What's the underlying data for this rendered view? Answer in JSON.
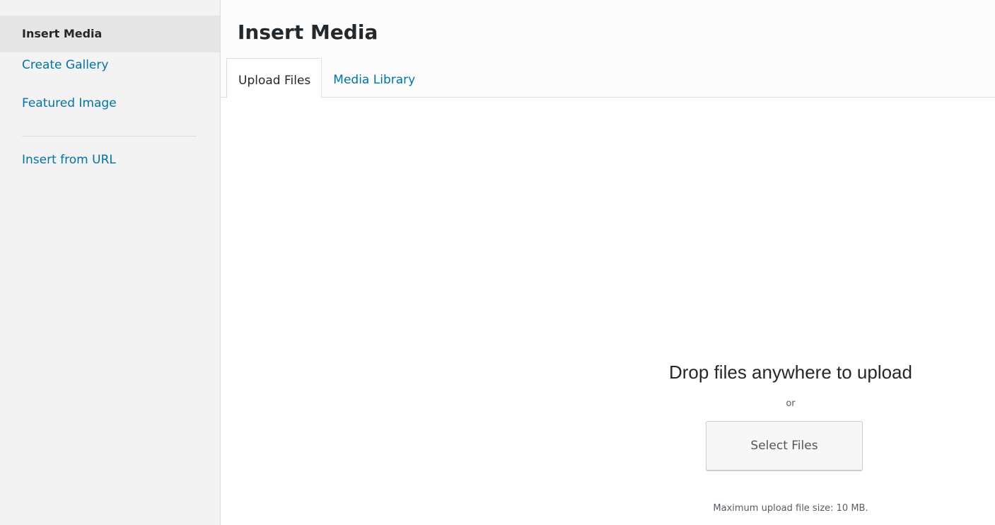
{
  "sidebar": {
    "items": [
      {
        "label": "Insert Media"
      },
      {
        "label": "Create Gallery"
      },
      {
        "label": "Featured Image"
      },
      {
        "label": "Insert from URL"
      }
    ]
  },
  "main": {
    "title": "Insert Media",
    "tabs": [
      {
        "label": "Upload Files"
      },
      {
        "label": "Media Library"
      }
    ]
  },
  "upload": {
    "drop_text": "Drop files anywhere to upload",
    "or_text": "or",
    "select_button": "Select Files",
    "max_size": "Maximum upload file size: 10 MB."
  },
  "colors": {
    "link": "#0073aa",
    "text": "#23282d",
    "sidebar_bg": "#f3f3f3",
    "active_bg": "#e6e6e6"
  }
}
